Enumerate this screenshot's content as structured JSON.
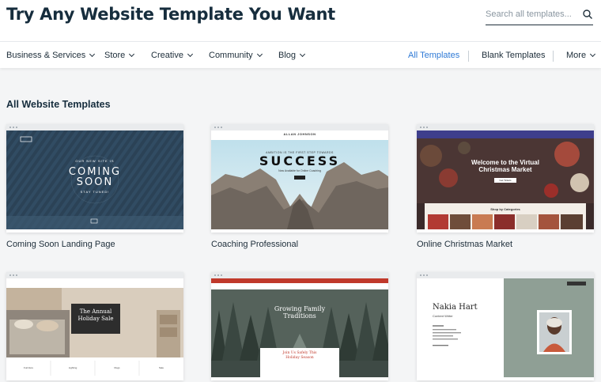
{
  "header": {
    "title": "Try Any Website Template You Want",
    "search_placeholder": "Search all templates..."
  },
  "nav": {
    "left_items": [
      {
        "label": "Business & Services"
      },
      {
        "label": "Store"
      },
      {
        "label": "Creative"
      },
      {
        "label": "Community"
      },
      {
        "label": "Blog"
      }
    ],
    "right_items": [
      {
        "label": "All Templates",
        "active": true
      },
      {
        "label": "Blank Templates"
      },
      {
        "label": "More"
      }
    ]
  },
  "section_title": "All Website Templates",
  "templates": [
    {
      "name": "Coming Soon Landing Page",
      "preview": {
        "eyebrow": "OUR NEW SITE IS",
        "headline_1": "COMING",
        "headline_2": "SOON",
        "tagline": "STAY TUNED!"
      }
    },
    {
      "name": "Coaching Professional",
      "preview": {
        "brand": "ALLAN JOHNSON",
        "headline": "SUCCESS",
        "eyebrow": "AMBITION IS THE FIRST STEP TOWARDS",
        "subtext": "Now Available for Online Coaching"
      }
    },
    {
      "name": "Online Christmas Market",
      "preview": {
        "headline_1": "Welcome to the Virtual",
        "headline_2": "Christmas Market",
        "button": "Get Tickets",
        "footer": "Shop by Categories"
      }
    },
    {
      "name": "",
      "preview": {
        "headline_1": "The Annual",
        "headline_2": "Holiday Sale",
        "categories": [
          "Furniture",
          "Lighting",
          "Rugs",
          "Sale"
        ]
      }
    },
    {
      "name": "",
      "preview": {
        "headline_1": "Growing Family",
        "headline_2": "Traditions",
        "cta_1": "Join Us Safely This",
        "cta_2": "Holiday Season"
      }
    },
    {
      "name": "",
      "preview": {
        "person": "Nakia Hart",
        "role": "Content Writer"
      }
    }
  ],
  "colors": {
    "accent": "#2f7ad6",
    "text": "#20303c",
    "background": "#f4f5f6"
  }
}
